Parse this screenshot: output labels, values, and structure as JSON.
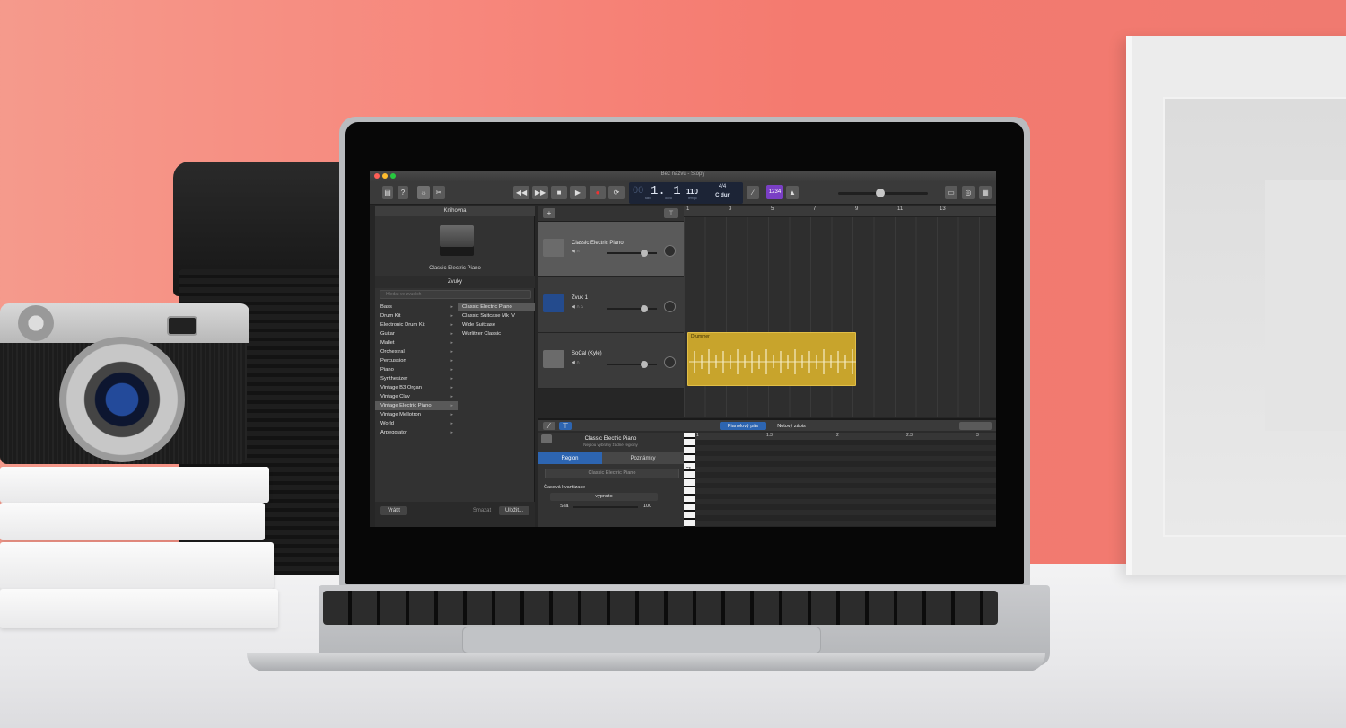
{
  "window": {
    "title": "Bez názvu - Stopy"
  },
  "transport": {
    "position_big": "1. 1",
    "position_faint": "00",
    "labels": [
      "takt",
      "doba"
    ],
    "tempo": "110",
    "tempo_label": "tempo",
    "time_signature": "4/4",
    "key": "C dur",
    "count_in": "1234"
  },
  "library": {
    "header": "Knihovna",
    "selected_patch": "Classic Electric Piano",
    "sounds_header": "Zvuky",
    "search_placeholder": "Hledat ve zvucích",
    "categories": [
      {
        "label": "Bass",
        "selected": false
      },
      {
        "label": "Drum Kit",
        "selected": false
      },
      {
        "label": "Electronic Drum Kit",
        "selected": false
      },
      {
        "label": "Guitar",
        "selected": false
      },
      {
        "label": "Mallet",
        "selected": false
      },
      {
        "label": "Orchestral",
        "selected": false
      },
      {
        "label": "Percussion",
        "selected": false
      },
      {
        "label": "Piano",
        "selected": false
      },
      {
        "label": "Synthesizer",
        "selected": false
      },
      {
        "label": "Vintage B3 Organ",
        "selected": false
      },
      {
        "label": "Vintage Clav",
        "selected": false
      },
      {
        "label": "Vintage Electric Piano",
        "selected": true
      },
      {
        "label": "Vintage Mellotron",
        "selected": false
      },
      {
        "label": "World",
        "selected": false
      },
      {
        "label": "Arpeggiator",
        "selected": false
      }
    ],
    "sounds": [
      {
        "label": "Classic Electric Piano",
        "selected": true
      },
      {
        "label": "Classic Suitcase Mk IV",
        "selected": false
      },
      {
        "label": "Wide Suitcase",
        "selected": false
      },
      {
        "label": "Wurlitzer Classic",
        "selected": false
      }
    ],
    "footer": {
      "revert": "Vrátit",
      "delete": "Smazat",
      "save": "Uložit..."
    }
  },
  "tracks": [
    {
      "name": "Classic Electric Piano",
      "icon": "piano-icon",
      "selected": true,
      "volume": 0.75
    },
    {
      "name": "Zvuk 1",
      "icon": "audio-wave-icon",
      "selected": false,
      "volume": 0.75
    },
    {
      "name": "SoCal (Kyle)",
      "icon": "drums-icon",
      "selected": false,
      "volume": 0.75
    }
  ],
  "ruler": {
    "bars": [
      "1",
      "3",
      "5",
      "7",
      "9",
      "11",
      "13"
    ]
  },
  "regions": [
    {
      "label": "Drummer",
      "track": 3,
      "color": "#c8a42c"
    }
  ],
  "editor": {
    "tabs": {
      "piano_roll": "Pianolový pás",
      "score": "Notový zápis"
    },
    "title": "Classic Electric Piano",
    "subtitle": "Nejsou vybrány žádné regiony",
    "segments": {
      "region": "Region",
      "notes": "Poznámky"
    },
    "region_name": "Classic Electric Piano",
    "quantize_label": "Časová kvantizace",
    "quantize_value": "vypnuto",
    "strength_label": "Síla",
    "strength_value": "100",
    "ruler": [
      "1",
      "1.3",
      "2",
      "2.3",
      "3"
    ],
    "key_label": "C2"
  },
  "colors": {
    "accent_blue": "#2d65b1",
    "count_in_purple": "#7a3fc5",
    "drummer_gold": "#c8a42c",
    "wall_coral": "#f47a6f"
  }
}
